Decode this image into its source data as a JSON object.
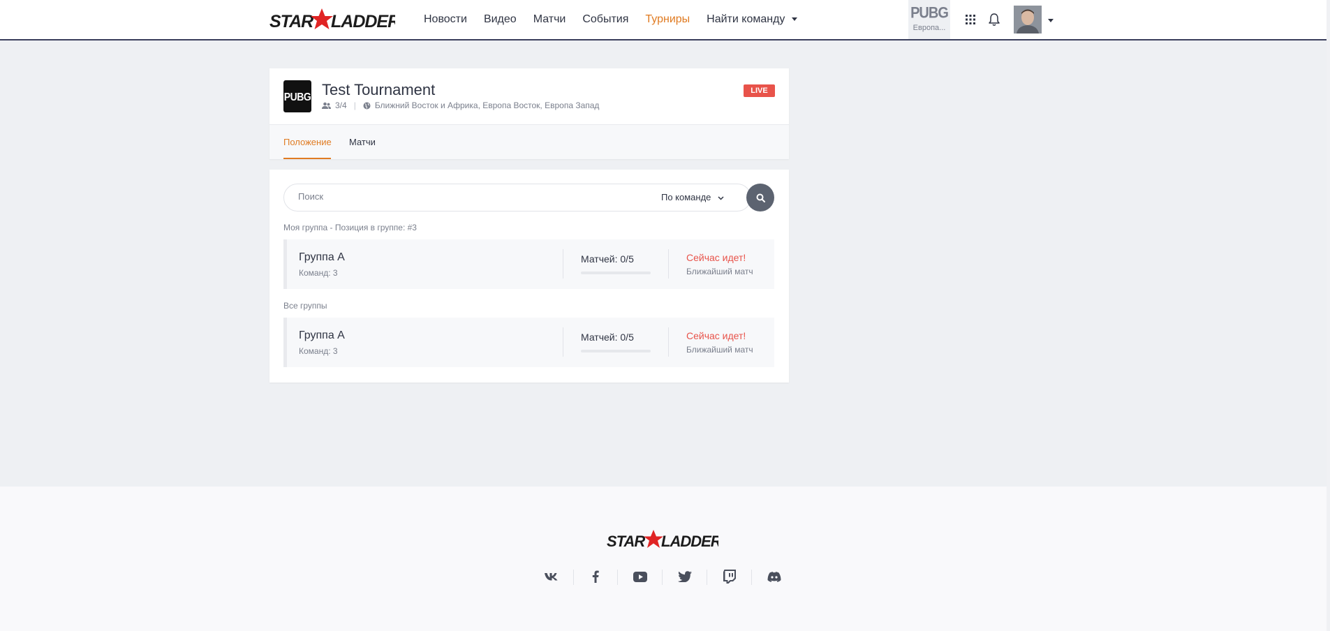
{
  "brand": {
    "logo_text": "STARLADDER"
  },
  "nav": {
    "items": [
      {
        "label": "Новости"
      },
      {
        "label": "Видео"
      },
      {
        "label": "Матчи"
      },
      {
        "label": "События"
      },
      {
        "label": "Турниры"
      },
      {
        "label": "Найти команду"
      }
    ],
    "active": "Турниры"
  },
  "game_switch": {
    "game": "PUBG",
    "region": "Европа..."
  },
  "header_icons": [
    "apps-grid-icon",
    "bell-icon",
    "avatar",
    "chevron-down-icon"
  ],
  "tournament": {
    "game_badge": "PUBG",
    "title": "Test Tournament",
    "teams": "3/4",
    "regions": "Ближний Восток и Африка, Европа Восток, Европа Запад",
    "status_badge": "LIVE",
    "tabs": [
      {
        "label": "Положение"
      },
      {
        "label": "Матчи"
      }
    ],
    "active_tab": "Положение"
  },
  "search": {
    "placeholder": "Поиск",
    "value": "",
    "filter_label": "По команде"
  },
  "my_group": {
    "section_label": "Моя группа - Позиция в группе: #3",
    "name": "Группа A",
    "teams": "Команд: 3",
    "matches": "Матчей: 0/5",
    "progress": 0,
    "status": "Сейчас идет!",
    "next": "Ближайший матч"
  },
  "all_groups": {
    "section_label": "Все группы",
    "items": [
      {
        "name": "Группа A",
        "teams": "Команд: 3",
        "matches": "Матчей: 0/5",
        "progress": 0,
        "status": "Сейчас идет!",
        "next": "Ближайший матч"
      }
    ]
  },
  "footer": {
    "logo_text": "STARLADDER",
    "social": [
      "vk-icon",
      "facebook-icon",
      "youtube-icon",
      "twitter-icon",
      "twitch-icon",
      "discord-icon"
    ]
  },
  "colors": {
    "accent": "#e07b22",
    "live": "#e8534a",
    "text": "#2f3443",
    "muted": "#7a7f8c",
    "background": "#eef0f3"
  }
}
